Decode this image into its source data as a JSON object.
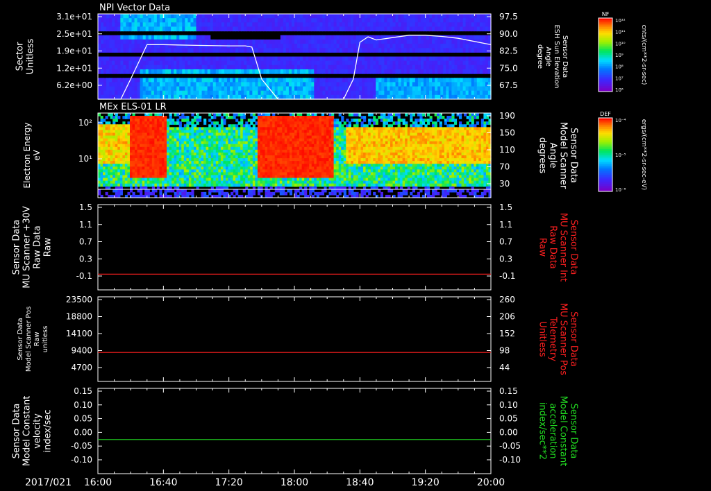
{
  "colors": {
    "background": "#000000",
    "axis": "#ffffff",
    "red_line": "#ff2020",
    "green_line": "#22dd22"
  },
  "chart_data": [
    {
      "type": "heatmap",
      "title": "NPI Vector Data",
      "ylabel_left": [
        "Sector",
        "Unitless"
      ],
      "ylabel_right": [
        "Sensor Data",
        "ESH Sun Elevation",
        "Angle",
        "degree"
      ],
      "left_ticks": [
        "3.1e+01",
        "2.5e+01",
        "1.9e+01",
        "1.2e+01",
        "6.2e+00"
      ],
      "right_ticks": [
        "97.5",
        "90.0",
        "82.5",
        "75.0",
        "67.5"
      ],
      "right_ylim": [
        61.5,
        97.5
      ],
      "overlay_line": {
        "color": "#ffffff",
        "x": [
          "16:00",
          "16:14",
          "16:20",
          "16:30",
          "16:40",
          "17:00",
          "17:20",
          "17:30",
          "17:34",
          "17:40",
          "17:50",
          "18:00",
          "18:10",
          "18:20",
          "18:30",
          "18:36",
          "18:40",
          "18:45",
          "18:50",
          "19:00",
          "19:10",
          "19:20",
          "19:30",
          "19:40",
          "20:00"
        ],
        "y": [
          55,
          55,
          70,
          84.5,
          84.5,
          84.2,
          84,
          84,
          83.5,
          70,
          55,
          55,
          55,
          55,
          55,
          70,
          85.5,
          87.8,
          86.5,
          87.5,
          88.5,
          88.5,
          88,
          87.2,
          84.5
        ]
      },
      "colorbar": {
        "label": "NF",
        "unit": "cnts/(cm**2-sr-sec)",
        "tick_labels": [
          "10¹²",
          "10¹¹",
          "10¹⁰",
          "10⁹",
          "10⁸",
          "10⁷",
          "10⁶"
        ]
      }
    },
    {
      "type": "heatmap",
      "title": "MEx ELS-01 LR",
      "ylabel_left": [
        "Electron Energy",
        "eV"
      ],
      "ylabel_right": [
        "Sensor Data",
        "Model Scanner",
        "Angle",
        "degrees"
      ],
      "left_ticks": [
        "10²",
        "10¹"
      ],
      "right_ticks": [
        "190",
        "150",
        "110",
        "70",
        "30"
      ],
      "right_ylim": [
        0,
        190
      ],
      "colorbar": {
        "label": "DEF",
        "unit": "ergs/(cm**2-sr-sec-eV)",
        "tick_labels": [
          "10⁻⁴",
          "10⁻⁵",
          "10⁻⁶"
        ]
      }
    },
    {
      "type": "line",
      "ylabel_left": [
        "Sensor Data",
        "MU Scanner +30V",
        "Raw Data",
        "Raw"
      ],
      "ylabel_right": [
        "Sensor Data",
        "MU Scanner Int",
        "Raw Data",
        "Raw"
      ],
      "left_ticks": [
        "1.5",
        "1.1",
        "0.7",
        "0.3",
        "-0.1"
      ],
      "right_ticks": [
        "1.5",
        "1.1",
        "0.7",
        "0.3",
        "-0.1"
      ],
      "ylim": [
        -0.4,
        1.5
      ],
      "series": [
        {
          "color": "#ff2020",
          "x": [
            "16:00",
            "20:00"
          ],
          "y": [
            -0.05,
            -0.05
          ]
        }
      ]
    },
    {
      "type": "line",
      "ylabel_left": [
        "Sensor Data",
        "Model Scanner Pos",
        "Raw",
        "unitless"
      ],
      "ylabel_right": [
        "Sensor Data",
        "MU Scanner Pos",
        "Telemetry",
        "Unitless"
      ],
      "left_ticks": [
        "23500",
        "18800",
        "14100",
        "9400",
        "4700"
      ],
      "right_ticks": [
        "260",
        "206",
        "152",
        "98",
        "44"
      ],
      "ylim": [
        0,
        23500
      ],
      "series": [
        {
          "color": "#ff2020",
          "x": [
            "16:00",
            "20:00"
          ],
          "y": [
            8050,
            8050
          ]
        }
      ]
    },
    {
      "type": "line",
      "ylabel_left": [
        "Sensor Data",
        "Model Constant",
        "velocity",
        "index/sec"
      ],
      "ylabel_right": [
        "Sensor Data",
        "Model Constant",
        "acceleration",
        "index/sec**2"
      ],
      "left_ticks": [
        "0.15",
        "0.10",
        "0.05",
        "0.00",
        "-0.05",
        "-0.10"
      ],
      "right_ticks": [
        "0.15",
        "0.10",
        "0.05",
        "0.00",
        "-0.05",
        "-0.10"
      ],
      "ylim": [
        -0.1,
        0.15
      ],
      "series": [
        {
          "color": "#22dd22",
          "x": [
            "16:00",
            "20:00"
          ],
          "y": [
            0.0,
            0.0
          ]
        }
      ]
    }
  ],
  "x_axis": {
    "date": "2017/021",
    "ticks": [
      "16:00",
      "16:40",
      "17:20",
      "18:00",
      "18:40",
      "19:20",
      "20:00"
    ]
  }
}
